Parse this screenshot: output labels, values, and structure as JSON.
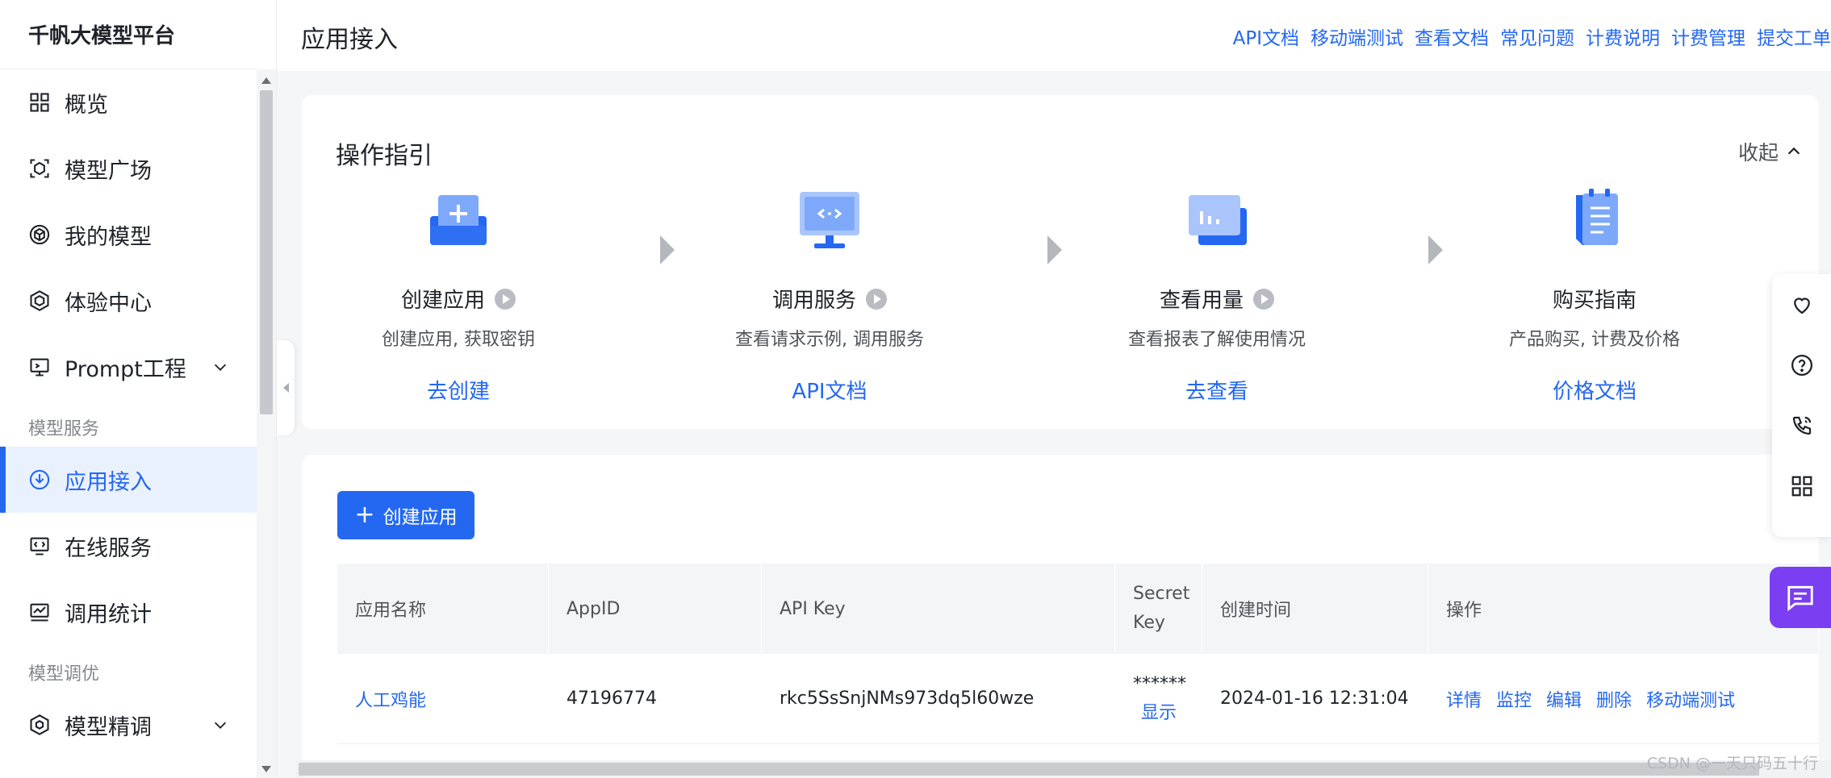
{
  "sidebar": {
    "brand": "千帆大模型平台",
    "items": [
      {
        "label": "概览"
      },
      {
        "label": "模型广场"
      },
      {
        "label": "我的模型"
      },
      {
        "label": "体验中心"
      },
      {
        "label": "Prompt工程"
      }
    ],
    "group_service": "模型服务",
    "service_items": [
      {
        "label": "应用接入"
      },
      {
        "label": "在线服务"
      },
      {
        "label": "调用统计"
      }
    ],
    "group_tune": "模型调优",
    "tune_items": [
      {
        "label": "模型精调"
      }
    ]
  },
  "header": {
    "title": "应用接入",
    "links": [
      "API文档",
      "移动端测试",
      "查看文档",
      "常见问题",
      "计费说明",
      "计费管理",
      "提交工单"
    ]
  },
  "guide": {
    "title": "操作指引",
    "collapse_label": "收起",
    "steps": [
      {
        "name": "创建应用",
        "desc": "创建应用, 获取密钥",
        "link": "去创建"
      },
      {
        "name": "调用服务",
        "desc": "查看请求示例, 调用服务",
        "link": "API文档"
      },
      {
        "name": "查看用量",
        "desc": "查看报表了解使用情况",
        "link": "去查看"
      },
      {
        "name": "购买指南",
        "desc": "产品购买, 计费及价格",
        "link": "价格文档"
      }
    ]
  },
  "table": {
    "create_label": "创建应用",
    "columns": [
      "应用名称",
      "AppID",
      "API Key",
      "Secret Key",
      "创建时间",
      "操作"
    ],
    "rows": [
      {
        "name": "人工鸡能",
        "appid": "47196774",
        "api_key": "rkc5SsSnjNMs973dq5l60wze",
        "secret_mask": "******",
        "secret_show": "显示",
        "created": "2024-01-16 12:31:04",
        "ops": [
          "详情",
          "监控",
          "编辑",
          "删除",
          "移动端测试"
        ]
      }
    ]
  },
  "watermark": "CSDN @一天只码五十行",
  "colors": {
    "accent": "#2468f2",
    "chat": "#7b3ef0"
  }
}
